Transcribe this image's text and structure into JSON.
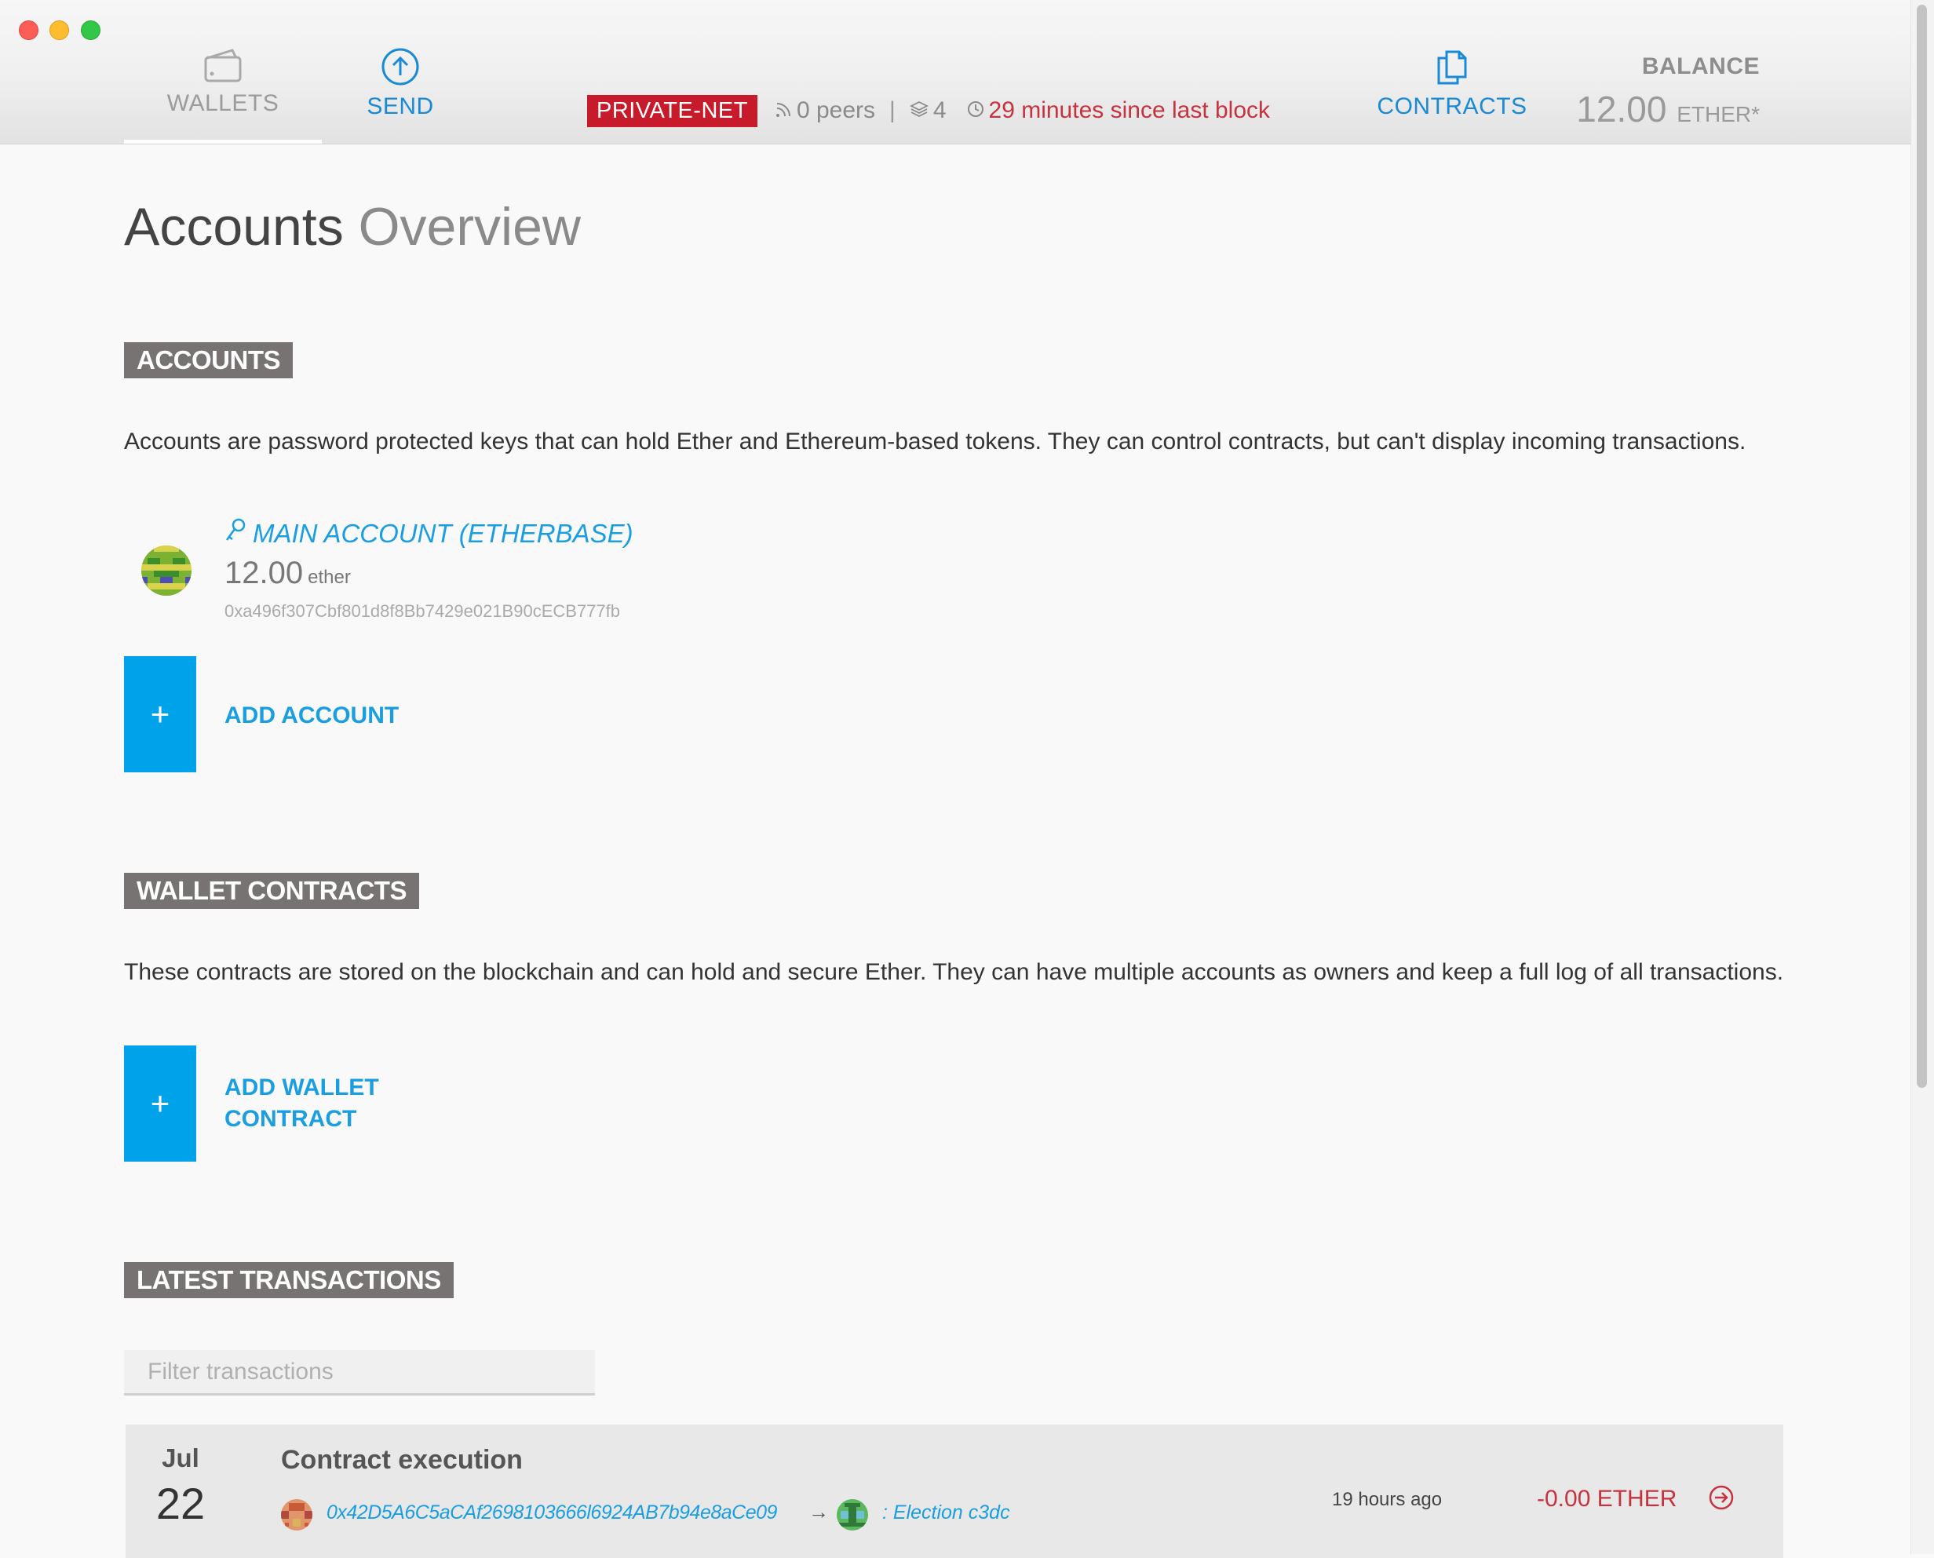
{
  "header": {
    "nav": {
      "wallets": "WALLETS",
      "send": "SEND",
      "contracts": "CONTRACTS"
    },
    "status": {
      "network": "PRIVATE-NET",
      "peers": "0 peers",
      "separator": "|",
      "block": "4",
      "since_last_block": "29 minutes since last block"
    },
    "balance": {
      "title": "BALANCE",
      "amount": "12.00",
      "unit": "ETHER*"
    }
  },
  "page": {
    "title_strong": "Accounts",
    "title_light": "Overview"
  },
  "accounts": {
    "heading": "ACCOUNTS",
    "description": "Accounts are password protected keys that can hold Ether and Ethereum-based tokens. They can control contracts, but can't display incoming transactions.",
    "items": [
      {
        "name": "MAIN ACCOUNT (ETHERBASE)",
        "balance": "12.00",
        "unit": "ether",
        "address": "0xa496f307Cbf801d8f8Bb7429e021B90cECB777fb"
      }
    ],
    "add_label": "ADD ACCOUNT",
    "add_symbol": "+"
  },
  "wallet_contracts": {
    "heading": "WALLET CONTRACTS",
    "description": "These contracts are stored on the blockchain and can hold and secure Ether. They can have multiple accounts as owners and keep a full log of all transactions.",
    "add_label_line1": "ADD WALLET",
    "add_label_line2": "CONTRACT",
    "add_symbol": "+"
  },
  "transactions": {
    "heading": "LATEST TRANSACTIONS",
    "filter_placeholder": "Filter transactions",
    "items": [
      {
        "month": "Jul",
        "day": "22",
        "type": "Contract execution",
        "from": "0x42D5A6C5aCAf2698103666l6924AB7b94e8aCe09",
        "arrow": "→",
        "to": ": Election c3dc",
        "time": "19 hours ago",
        "amount": "-0.00 ETHER"
      }
    ]
  },
  "colors": {
    "accent": "#1a9ee0",
    "button": "#00a3e9",
    "alert": "#c7323f",
    "badge": "#c71a2a",
    "section_head": "#787373"
  },
  "icons": [
    "wallet-icon",
    "send-arrow-icon",
    "contracts-icon",
    "peers-icon",
    "blocks-icon",
    "clock-icon",
    "key-icon",
    "arrow-circle-icon"
  ]
}
